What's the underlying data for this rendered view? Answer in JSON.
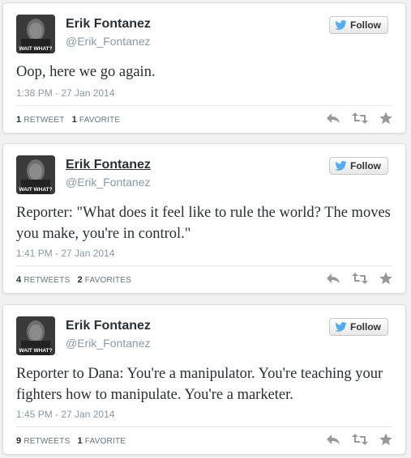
{
  "labels": {
    "follow": "Follow",
    "retweets_singular": "RETWEET",
    "retweets_plural": "RETWEETS",
    "favorites_singular": "FAVORITE",
    "favorites_plural": "FAVORITES"
  },
  "avatar_caption": "WAIT WHAT?",
  "colors": {
    "twitter_blue": "#55acee",
    "action_gray": "#999999"
  },
  "tweets": [
    {
      "name": "Erik Fontanez",
      "handle": "@Erik_Fontanez",
      "follow_label": "Follow",
      "text": "Oop, here we go again.",
      "timestamp": "1:38 PM - 27 Jan 2014",
      "retweet_count": "1",
      "retweet_label": "RETWEET",
      "favorite_count": "1",
      "favorite_label": "FAVORITE",
      "name_underlined": false
    },
    {
      "name": "Erik Fontanez",
      "handle": "@Erik_Fontanez",
      "follow_label": "Follow",
      "text": "Reporter: \"What does it feel like to rule the world? The moves you make, you're in control.\"",
      "timestamp": "1:41 PM - 27 Jan 2014",
      "retweet_count": "4",
      "retweet_label": "RETWEETS",
      "favorite_count": "2",
      "favorite_label": "FAVORITES",
      "name_underlined": true
    },
    {
      "name": "Erik Fontanez",
      "handle": "@Erik_Fontanez",
      "follow_label": "Follow",
      "text": "Reporter to Dana: You're a manipulator. You're teaching your fighters how to manipulate. You're a marketer.",
      "timestamp": "1:45 PM - 27 Jan 2014",
      "retweet_count": "9",
      "retweet_label": "RETWEETS",
      "favorite_count": "1",
      "favorite_label": "FAVORITE",
      "name_underlined": false
    }
  ]
}
